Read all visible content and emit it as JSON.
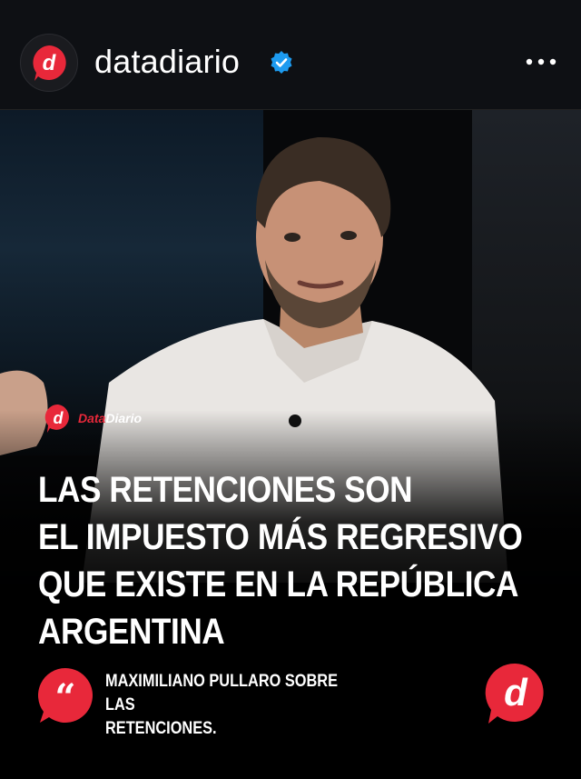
{
  "header": {
    "username": "datadiario",
    "verified": true,
    "avatar_icon": "datadiario-logo-icon",
    "more_icon": "more-options-icon"
  },
  "post": {
    "watermark": {
      "part1": "Data",
      "part2": "Diario"
    },
    "headline_lines": [
      "LAS RETENCIONES SON",
      "EL IMPUESTO MÁS REGRESIVO",
      "QUE EXISTE EN LA REPÚBLICA",
      "ARGENTINA"
    ],
    "caption_lines": [
      "MAXIMILIANO PULLARO SOBRE LAS",
      "RETENCIONES."
    ],
    "quote_icon": "quote-icon",
    "brand_icon": "datadiario-logo-icon"
  },
  "colors": {
    "brand_red": "#e8283a",
    "verified_blue": "#1d9bf0",
    "background": "#0b0c0e"
  }
}
